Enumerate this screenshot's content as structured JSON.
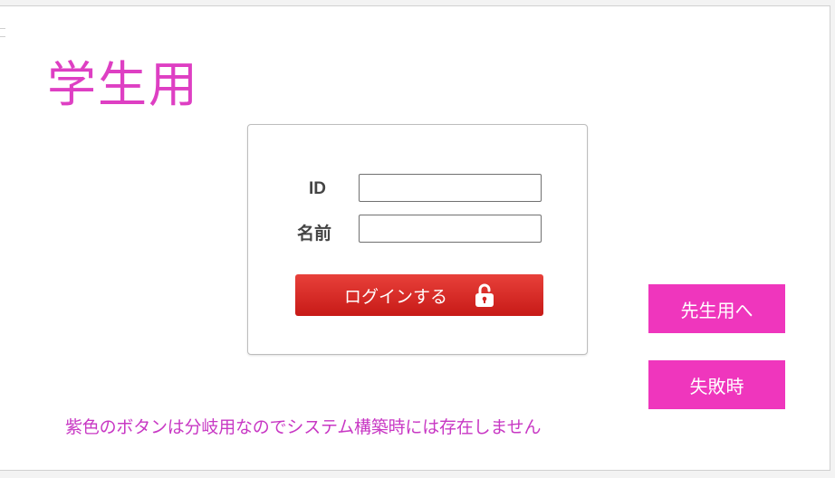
{
  "page": {
    "title": "学生用"
  },
  "login_form": {
    "id_label": "ID",
    "id_value": "",
    "id_placeholder": "",
    "name_label": "名前",
    "name_value": "",
    "name_placeholder": "",
    "submit_label": "ログインする",
    "submit_icon": "lock-open-icon",
    "submit_color": "#d42420"
  },
  "side_buttons": {
    "teacher_label": "先生用へ",
    "fail_label": "失敗時",
    "color": "#ef36bd"
  },
  "note": {
    "text": "紫色のボタンは分岐用なのでシステム構築時には存在しません",
    "color": "#c838c4"
  },
  "colors": {
    "title": "#de3fc3",
    "background": "#ffffff"
  }
}
